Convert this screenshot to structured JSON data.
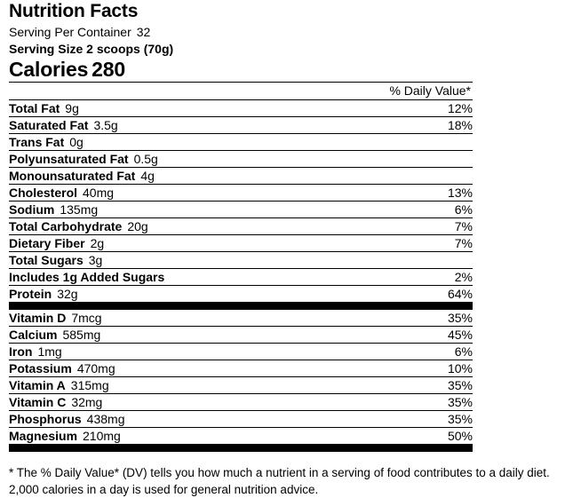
{
  "header": {
    "title": "Nutrition Facts",
    "serving_per_container_label": "Serving Per Container",
    "serving_per_container_value": "32",
    "serving_size": "Serving Size 2 scoops (70g)",
    "calories_label": "Calories",
    "calories_value": "280"
  },
  "table": {
    "dv_header": "% Daily Value*",
    "rows": [
      {
        "name": "Total Fat",
        "amount": "9g",
        "dv": "12%",
        "indent": 0,
        "bold_all": false
      },
      {
        "name": "Saturated Fat",
        "amount": "3.5g",
        "dv": "18%",
        "indent": 1,
        "bold_all": false
      },
      {
        "name": "Trans Fat",
        "amount": "0g",
        "dv": "",
        "indent": 1,
        "bold_all": false
      },
      {
        "name": "Polyunsaturated Fat",
        "amount": "0.5g",
        "dv": "",
        "indent": 1,
        "bold_all": false
      },
      {
        "name": "Monounsaturated Fat",
        "amount": "4g",
        "dv": "",
        "indent": 1,
        "bold_all": false
      },
      {
        "name": "Cholesterol",
        "amount": "40mg",
        "dv": "13%",
        "indent": 0,
        "bold_all": false
      },
      {
        "name": "Sodium",
        "amount": "135mg",
        "dv": "6%",
        "indent": 0,
        "bold_all": false
      },
      {
        "name": "Total Carbohydrate",
        "amount": "20g",
        "dv": "7%",
        "indent": 0,
        "bold_all": false
      },
      {
        "name": "Dietary Fiber",
        "amount": "2g",
        "dv": "7%",
        "indent": 1,
        "bold_all": false
      },
      {
        "name": "Total Sugars",
        "amount": "3g",
        "dv": "",
        "indent": 1,
        "bold_all": false
      },
      {
        "name": "Includes 1g Added Sugars",
        "amount": "",
        "dv": "2%",
        "indent": 2,
        "bold_all": true
      },
      {
        "name": "Protein",
        "amount": "32g",
        "dv": "64%",
        "indent": 0,
        "bold_all": false
      }
    ],
    "micronutrients": [
      {
        "name": "Vitamin D",
        "amount": "7mcg",
        "dv": "35%"
      },
      {
        "name": "Calcium",
        "amount": "585mg",
        "dv": "45%"
      },
      {
        "name": "Iron",
        "amount": "1mg",
        "dv": "6%"
      },
      {
        "name": "Potassium",
        "amount": "470mg",
        "dv": "10%"
      },
      {
        "name": "Vitamin A",
        "amount": "315mg",
        "dv": "35%"
      },
      {
        "name": "Vitamin C",
        "amount": "32mg",
        "dv": "35%"
      },
      {
        "name": "Phosphorus",
        "amount": "438mg",
        "dv": "35%"
      },
      {
        "name": "Magnesium",
        "amount": "210mg",
        "dv": "50%"
      }
    ]
  },
  "footnote": {
    "line1": "* The % Daily Value* (DV) tells you how much a nutrient in a serving of food contributes to a daily diet.",
    "line2": "2,000 calories in a day is used for general nutrition advice."
  },
  "colors": {
    "text": "#000000",
    "rule": "#000000",
    "bar": "#000000",
    "background": "#ffffff"
  }
}
